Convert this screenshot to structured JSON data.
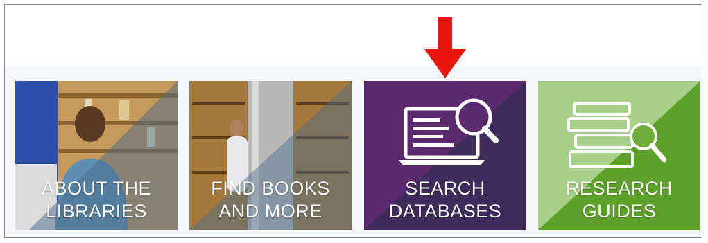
{
  "tiles": [
    {
      "line1": "ABOUT THE",
      "line2": "LIBRARIES"
    },
    {
      "line1": "FIND BOOKS",
      "line2": "AND MORE"
    },
    {
      "line1": "SEARCH",
      "line2": "DATABASES"
    },
    {
      "line1": "RESEARCH",
      "line2": "GUIDES"
    }
  ],
  "icons": {
    "annotation": "red-down-arrow-icon",
    "databases": "laptop-magnifier-icon",
    "guides": "books-magnifier-icon"
  },
  "colors": {
    "annotation_arrow": "#e8160c",
    "databases_tile": "#5b2a6e",
    "databases_tile_dark": "#3f2b5c",
    "guides_tile": "#7bb640",
    "guides_tile_dark": "#5ea12a",
    "overlay": "#4a6a8a"
  }
}
